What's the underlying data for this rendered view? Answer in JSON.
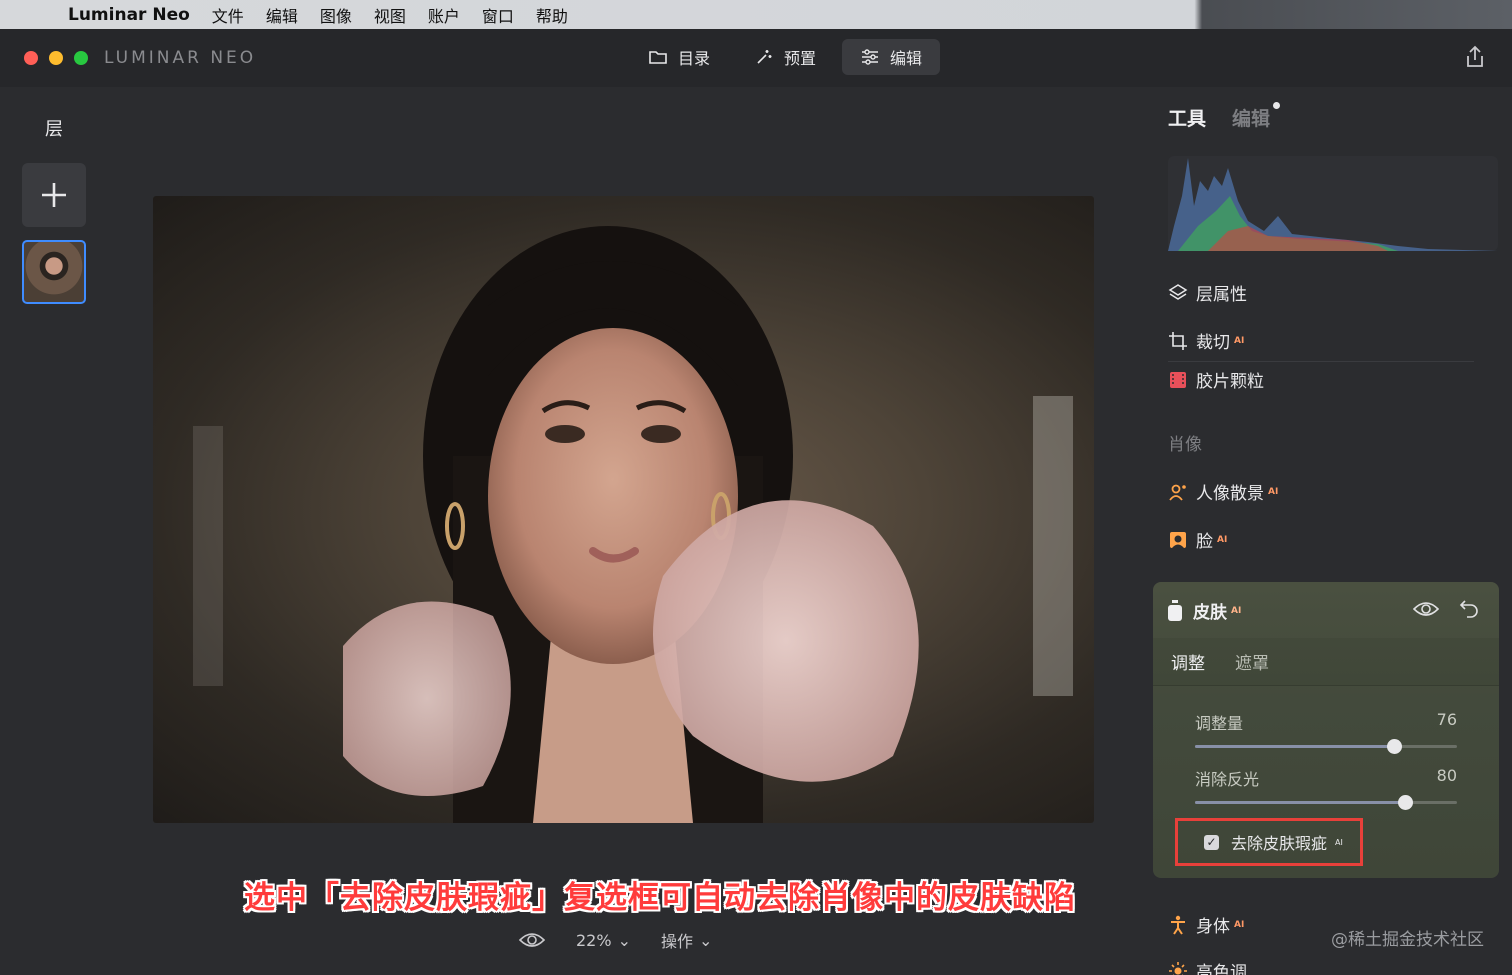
{
  "menubar": {
    "app_name": "Luminar Neo",
    "items": [
      "文件",
      "编辑",
      "图像",
      "视图",
      "账户",
      "窗口",
      "帮助"
    ]
  },
  "window": {
    "brand_left": "LUMINAR",
    "brand_right": "NEO",
    "nav": [
      {
        "label": "目录",
        "icon": "folder-icon"
      },
      {
        "label": "预置",
        "icon": "magic-wand-icon"
      },
      {
        "label": "编辑",
        "icon": "sliders-icon",
        "active": true
      }
    ]
  },
  "layers": {
    "title": "层"
  },
  "caption": "选中「去除皮肤瑕疵」复选框可自动去除肖像中的皮肤缺陷",
  "bottombar": {
    "zoom": "22%",
    "actions": "操作"
  },
  "right_panel": {
    "tabs": {
      "tools": "工具",
      "edits": "编辑"
    },
    "tools": {
      "layer_props": "层属性",
      "crop": "裁切",
      "film_grain": "胶片颗粒"
    },
    "section_portrait": "肖像",
    "portrait_tools": {
      "portrait_bokeh": "人像散景",
      "face": "脸",
      "body": "身体",
      "highkey": "高色调"
    },
    "ai_badge": "AI",
    "skin": {
      "title": "皮肤",
      "subtabs": [
        "调整",
        "遮罩"
      ],
      "sliders": [
        {
          "label": "调整量",
          "value": "76",
          "fraction": 0.76
        },
        {
          "label": "消除反光",
          "value": "80",
          "fraction": 0.8
        }
      ],
      "checkbox_label": "去除皮肤瑕疵",
      "checkbox_checked": true
    }
  },
  "watermark": "@稀土掘金技术社区"
}
